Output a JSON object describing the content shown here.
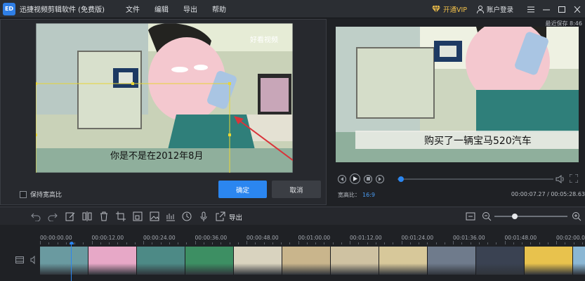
{
  "app": {
    "logo_text": "ED",
    "title": "迅捷视频剪辑软件 (免费版)"
  },
  "menu": [
    {
      "label": "文件"
    },
    {
      "label": "编辑"
    },
    {
      "label": "导出"
    },
    {
      "label": "帮助"
    }
  ],
  "header_right": {
    "vip_label": "开通VIP",
    "account_label": "账户登录"
  },
  "editor": {
    "watermark": "好看视频",
    "subtitle": "你是不是在2012年8月",
    "keep_ratio_label": "保持宽高比",
    "keep_ratio_checked": false,
    "ok_label": "确定",
    "cancel_label": "取消"
  },
  "preview": {
    "save_status": "最近保存 8:46",
    "subtitle": "购买了一辆宝马520汽车",
    "aspect_label": "宽高比：",
    "aspect_value": "16:9",
    "time_readout": "00:00:07.27 / 00:05:28.63",
    "progress_fraction": 0.02
  },
  "toolbar": {
    "export_label": "导出",
    "zoom_fraction": 0.28
  },
  "timeline": {
    "ticks": [
      "00:00:00.00",
      "00:00:12.00",
      "00:00:24.00",
      "00:00:36.00",
      "00:00:48.00",
      "00:01:00.00",
      "00:01:12.00",
      "00:01:24.00",
      "00:01:36.00",
      "00:01:48.00",
      "00:02:00.00"
    ],
    "clip_colors": [
      "#6a9aa0",
      "#e7a8c7",
      "#4d8a86",
      "#3d8f63",
      "#d9d3bf",
      "#c9b58c",
      "#cfc2a2",
      "#d7c89a",
      "#6f7b8c",
      "#3a4252",
      "#e8c24d",
      "#8bb7d4"
    ]
  },
  "colors": {
    "accent": "#2b86f0",
    "vip": "#f1c04a",
    "crop_frame": "#e8d535",
    "arrow": "#d9343a"
  }
}
